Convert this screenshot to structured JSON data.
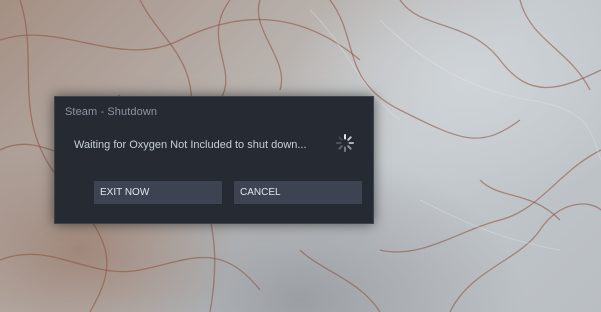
{
  "dialog": {
    "title": "Steam - Shutdown",
    "message": "Waiting for Oxygen Not Included to shut down...",
    "buttons": {
      "exit_now": "EXIT NOW",
      "cancel": "CANCEL"
    },
    "icons": {
      "loading": "loading-spinner-icon"
    },
    "colors": {
      "background": "#262a33",
      "title_text": "#8b95a3",
      "message_text": "#c6d0da",
      "button_bg": "#3d4350",
      "button_text": "#e1e6ea"
    }
  }
}
